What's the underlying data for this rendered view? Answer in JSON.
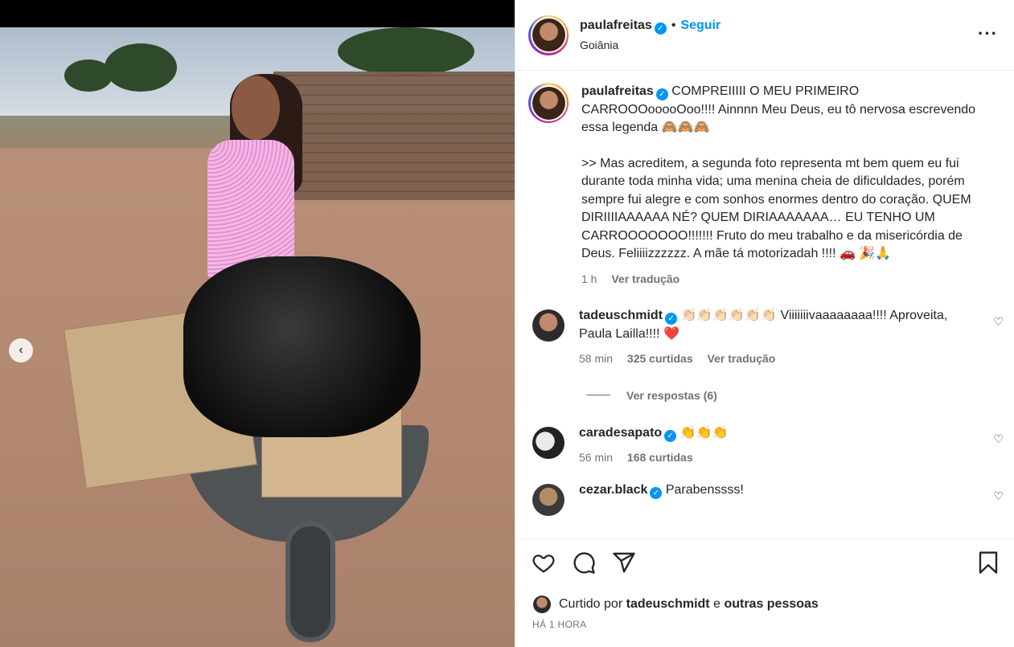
{
  "post": {
    "username": "paulafreitas",
    "verified": true,
    "follow_label": "Seguir",
    "location": "Goiânia",
    "more_icon": "more-horizontal-icon"
  },
  "caption": {
    "username": "paulafreitas",
    "line1": "COMPREIIIII O MEU PRIMEIRO CARROOOooooOoo!!!! Ainnnn Meu Deus, eu tô nervosa escrevendo essa legenda 🙈🙈🙈",
    "line2": ">> Mas acreditem, a segunda foto representa mt bem quem eu fui durante toda minha vida; uma menina cheia de dificuldades, porém sempre fui alegre e com sonhos enormes dentro do coração. QUEM DIRIIIIAAAAAA NÉ? QUEM DIRIAAAAAAA… EU TENHO UM CARROOOOOOO!!!!!!! Fruto do meu trabalho e da misericórdia de Deus. Feliiiizzzzzz. A mãe tá motorizadah !!!! 🚗 🎉🙏",
    "time": "1 h",
    "translate": "Ver tradução"
  },
  "comments": [
    {
      "username": "tadeuschmidt",
      "text": "👏🏻👏🏻👏🏻👏🏻👏🏻👏🏻 Viiiiiiivaaaaaaaa!!!! Aproveita, Paula Lailla!!!! ❤️",
      "time": "58 min",
      "likes": "325 curtidas",
      "translate": "Ver tradução",
      "replies": "Ver respostas (6)"
    },
    {
      "username": "caradesapato",
      "text": "👏👏👏",
      "time": "56 min",
      "likes": "168 curtidas"
    },
    {
      "username": "cezar.black",
      "text": "Parabenssss!"
    }
  ],
  "footer": {
    "liked_prefix": "Curtido por",
    "liked_user": "tadeuschmidt",
    "liked_and": "e",
    "liked_others": "outras pessoas",
    "timestamp": "HÁ 1 HORA"
  },
  "colors": {
    "accent": "#0095f6",
    "text": "#262626",
    "muted": "#737373",
    "heart": "#ed4956"
  }
}
